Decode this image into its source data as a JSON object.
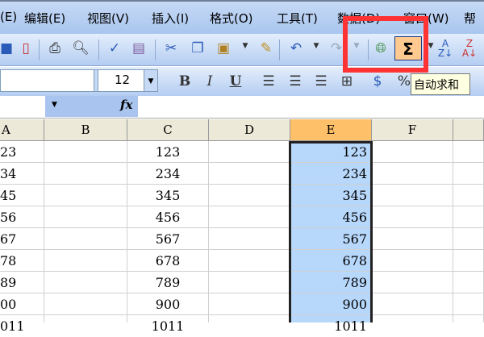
{
  "menu": [
    "(E)",
    "编辑(E)",
    "视图(V)",
    "插入(I)",
    "格式(O)",
    "工具(T)",
    "数据(D)",
    "窗口(W)",
    "帮"
  ],
  "toolbar": {
    "font_size": "12",
    "bold": "B",
    "italic": "I",
    "underline": "U",
    "percent": "%",
    "autosum": "Σ",
    "tooltip": "自动求和",
    "fx": "fx"
  },
  "columns": [
    "A",
    "B",
    "C",
    "D",
    "E",
    "F"
  ],
  "rows": [
    {
      "a": "23",
      "c": "123",
      "e": "123"
    },
    {
      "a": "34",
      "c": "234",
      "e": "234"
    },
    {
      "a": "45",
      "c": "345",
      "e": "345"
    },
    {
      "a": "56",
      "c": "456",
      "e": "456"
    },
    {
      "a": "67",
      "c": "567",
      "e": "567"
    },
    {
      "a": "78",
      "c": "678",
      "e": "678"
    },
    {
      "a": "89",
      "c": "789",
      "e": "789"
    },
    {
      "a": "00",
      "c": "900",
      "e": "900"
    },
    {
      "a": "011",
      "c": "1011",
      "e": "1011"
    }
  ],
  "colors": {
    "selected_header": "#ffc06a",
    "selection": "#b7d7fb",
    "highlight": "#ff3333"
  }
}
